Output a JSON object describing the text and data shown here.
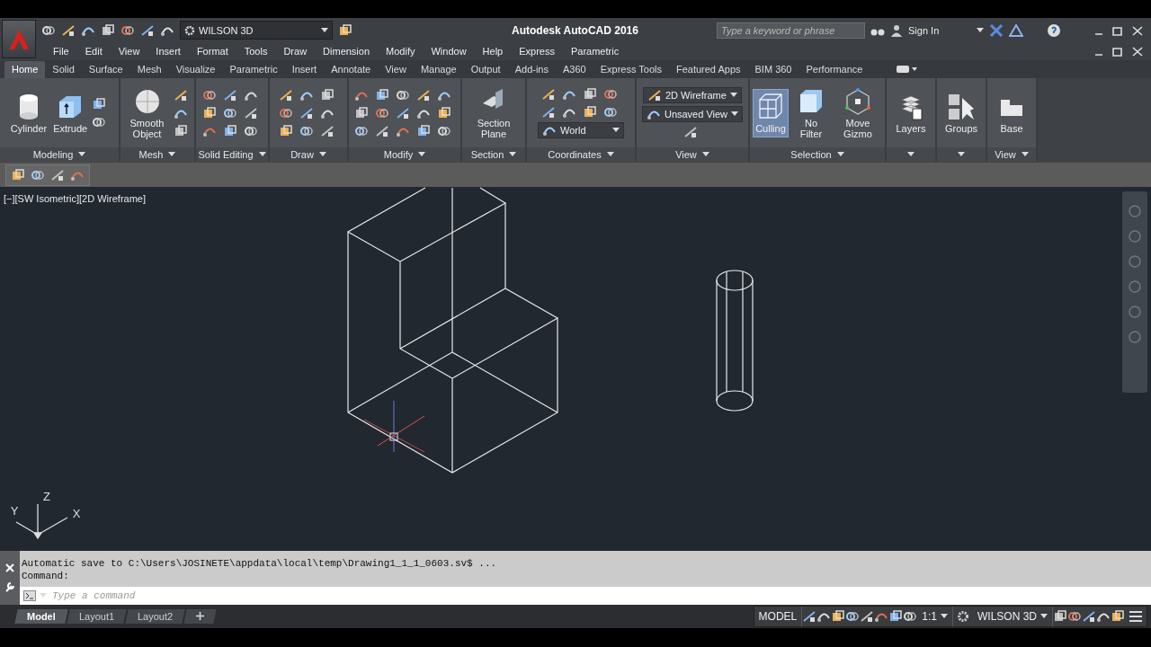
{
  "title_bar": {
    "workspace": "WILSON 3D",
    "title": "Autodesk AutoCAD 2016",
    "search": {
      "placeholder": "Type a keyword or phrase"
    },
    "sign_in": "Sign In"
  },
  "menu_bar": [
    "File",
    "Edit",
    "View",
    "Insert",
    "Format",
    "Tools",
    "Draw",
    "Dimension",
    "Modify",
    "Window",
    "Help",
    "Express",
    "Parametric"
  ],
  "ribbon_tabs": [
    {
      "label": "Home",
      "selected": true
    },
    {
      "label": "Solid",
      "selected": false
    },
    {
      "label": "Surface",
      "selected": false
    },
    {
      "label": "Mesh",
      "selected": false
    },
    {
      "label": "Visualize",
      "selected": false
    },
    {
      "label": "Parametric",
      "selected": false
    },
    {
      "label": "Insert",
      "selected": false
    },
    {
      "label": "Annotate",
      "selected": false
    },
    {
      "label": "View",
      "selected": false
    },
    {
      "label": "Manage",
      "selected": false
    },
    {
      "label": "Output",
      "selected": false
    },
    {
      "label": "Add-ins",
      "selected": false
    },
    {
      "label": "A360",
      "selected": false
    },
    {
      "label": "Express Tools",
      "selected": false
    },
    {
      "label": "Featured Apps",
      "selected": false
    },
    {
      "label": "BIM 360",
      "selected": false
    },
    {
      "label": "Performance",
      "selected": false
    }
  ],
  "ribbon_panels": [
    {
      "title": "Modeling",
      "items": [
        {
          "kind": "large",
          "label": "Cylinder",
          "on": false
        },
        {
          "kind": "large",
          "label": "Extrude",
          "on": false
        },
        {
          "kind": "icons"
        }
      ]
    },
    {
      "title": "Mesh",
      "items": [
        {
          "kind": "large",
          "label": "Smooth Object",
          "on": false
        },
        {
          "kind": "icons"
        }
      ]
    },
    {
      "title": "Solid Editing",
      "items": [
        {
          "kind": "icons"
        }
      ]
    },
    {
      "title": "Draw",
      "items": [
        {
          "kind": "icons"
        }
      ]
    },
    {
      "title": "Modify",
      "items": [
        {
          "kind": "icons"
        }
      ]
    },
    {
      "title": "Section",
      "items": [
        {
          "kind": "large",
          "label": "Section Plane",
          "on": false
        }
      ]
    },
    {
      "title": "Coordinates",
      "items": [
        {
          "kind": "icons"
        },
        {
          "kind": "dropdown",
          "value": "World"
        }
      ]
    },
    {
      "title": "View",
      "items": [
        {
          "kind": "dropdown",
          "value": "2D Wireframe"
        },
        {
          "kind": "dropdown",
          "value": "Unsaved View"
        },
        {
          "kind": "icons"
        }
      ]
    },
    {
      "title": "Selection",
      "items": [
        {
          "kind": "large",
          "label": "Culling",
          "on": true
        },
        {
          "kind": "large",
          "label": "No Filter",
          "on": false
        },
        {
          "kind": "large",
          "label": "Move Gizmo",
          "on": false
        }
      ]
    },
    {
      "items": [
        {
          "kind": "large",
          "label": "Layers",
          "on": false
        }
      ]
    },
    {
      "items": [
        {
          "kind": "large",
          "label": "Groups",
          "on": false
        }
      ]
    },
    {
      "title": "View",
      "items": [
        {
          "kind": "large",
          "label": "Base",
          "on": false
        }
      ]
    }
  ],
  "viewport": {
    "label": "[−][SW Isometric][2D Wireframe]",
    "ucs": {
      "z": "Z",
      "x": "X",
      "y": "Y"
    }
  },
  "command_line": {
    "history": [
      "Automatic save to C:\\Users\\JOSINETE\\appdata\\local\\temp\\Drawing1_1_1_0603.sv$ ...",
      "Command:"
    ],
    "placeholder": "Type a command"
  },
  "layout_tabs": [
    {
      "label": "Model",
      "selected": true
    },
    {
      "label": "Layout1",
      "selected": false
    },
    {
      "label": "Layout2",
      "selected": false
    }
  ],
  "status_bar": {
    "model": "MODEL",
    "scale": "1:1",
    "workspace": "WILSON 3D"
  }
}
